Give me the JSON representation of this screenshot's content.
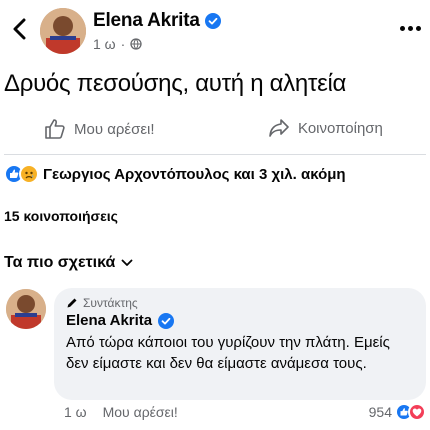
{
  "post": {
    "author": "Elena Akrita",
    "time": "1 ω",
    "separator": "·",
    "text": "Δρυός πεσούσης, αυτή η αλητεία",
    "like_label": "Μου αρέσει!",
    "share_label": "Κοινοποίηση",
    "reactions_summary": "Γεωργιος Αρχοντόπουλος και 3 χιλ. ακόμη",
    "shares_count": "15 κοινοποιήσεις"
  },
  "sort": {
    "label": "Τα πιο σχετικά"
  },
  "comment": {
    "role": "Συντάκτης",
    "author": "Elena Akrita",
    "text": "Από τώρα κάποιοι του γυρίζουν την πλάτη. Εμείς δεν είμαστε και δεν θα είμαστε ανάμεσα τους.",
    "time": "1 ω",
    "like_label": "Μου αρέσει!",
    "reaction_count": "954"
  },
  "colors": {
    "facebook_blue": "#1877f2",
    "love_red": "#f33e58",
    "sad_yellow": "#f7b125",
    "secondary_text": "#65676b",
    "bubble_bg": "#f0f2f5"
  },
  "icons": [
    "back-chevron-icon",
    "verified-badge-icon",
    "globe-icon",
    "more-options-icon",
    "thumbs-up-icon",
    "share-arrow-icon",
    "like-reaction-icon",
    "sad-reaction-icon",
    "love-reaction-icon",
    "pencil-icon",
    "chevron-down-icon"
  ]
}
